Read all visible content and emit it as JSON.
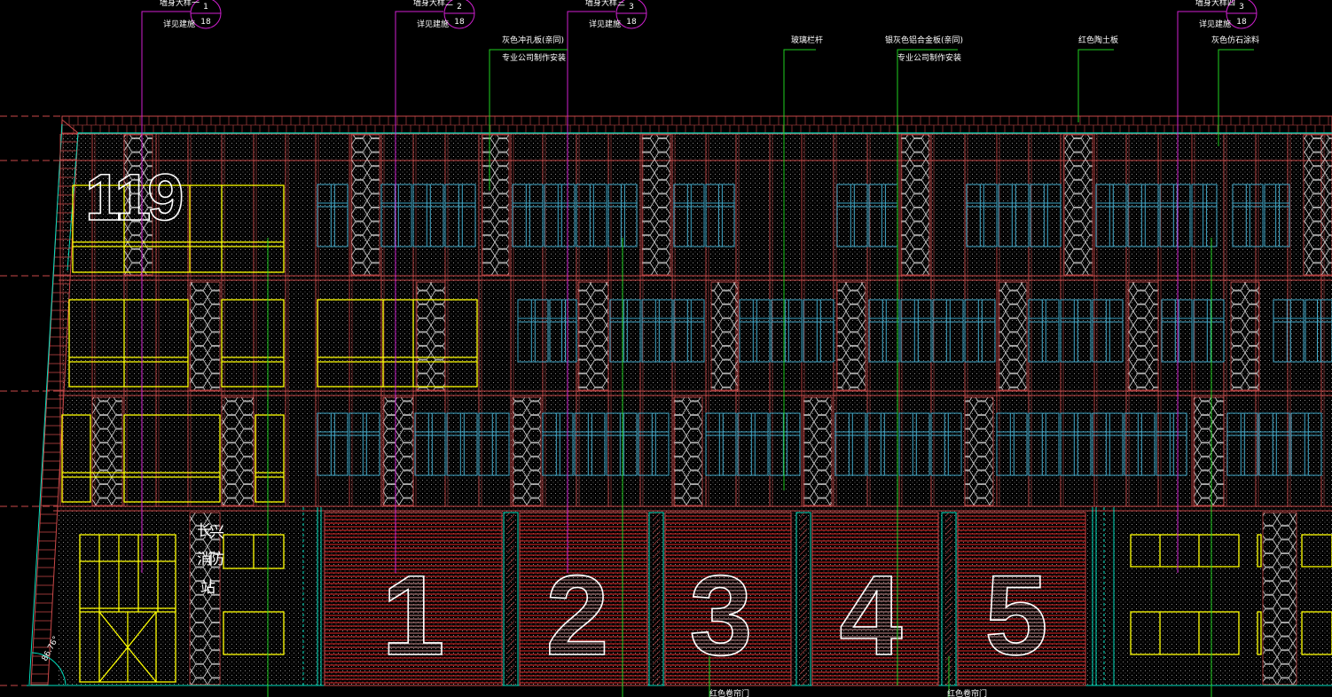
{
  "drawing": {
    "station_number": "119",
    "station_name_chars": [
      "长",
      "兴",
      "消",
      "防",
      "站"
    ],
    "bay_numbers": [
      "1",
      "2",
      "3",
      "4",
      "5"
    ],
    "angle_label": "86.76°"
  },
  "callouts": [
    {
      "line1": "墙身大样一",
      "line2": "详见建施",
      "circle_top": "1",
      "circle_bottom": "18"
    },
    {
      "line1": "墙身大样二",
      "line2": "详见建施",
      "circle_top": "2",
      "circle_bottom": "18"
    },
    {
      "line1": "墙身大样三",
      "line2": "详见建施",
      "circle_top": "3",
      "circle_bottom": "18"
    },
    {
      "line1": "墙身大样四",
      "line2": "详见建施",
      "circle_top": "3",
      "circle_bottom": "18"
    }
  ],
  "material_notes": [
    {
      "line1": "灰色冲孔板(亲同)",
      "line2": "专业公司制作安装"
    },
    {
      "line1": "玻璃栏杆",
      "line2": ""
    },
    {
      "line1": "银灰色铝合金板(亲同)",
      "line2": "专业公司制作安装"
    },
    {
      "line1": "红色陶土板",
      "line2": ""
    },
    {
      "line1": "灰色仿石涂料",
      "line2": ""
    }
  ],
  "bottom_notes": [
    "红色卷帘门",
    "红色卷帘门"
  ],
  "colors": {
    "background": "#000000",
    "grid_red": "#c84848",
    "outline_cyan": "#00e0c0",
    "window_yellow": "#ffff00",
    "window_blue": "#40a8c8",
    "leader_magenta": "#d020d0",
    "leader_green": "#20d020",
    "door_red": "#c02020"
  }
}
